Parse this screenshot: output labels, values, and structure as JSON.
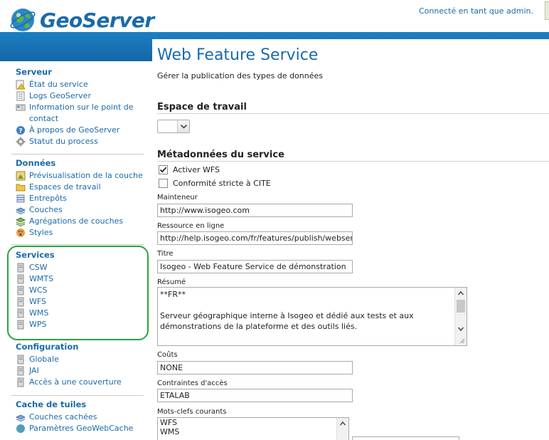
{
  "header": {
    "brand": "GeoServer",
    "login_status": "Connecté en tant que admin."
  },
  "sidebar": {
    "sections": [
      {
        "title": "Serveur",
        "items": [
          {
            "label": "État du service",
            "icon": "warning-icon"
          },
          {
            "label": "Logs GeoServer",
            "icon": "log-icon"
          },
          {
            "label": "Information sur le point de contact",
            "icon": "contact-card-icon"
          },
          {
            "label": "À propos de GeoServer",
            "icon": "help-icon"
          },
          {
            "label": "Statut du process",
            "icon": "gear-icon"
          }
        ]
      },
      {
        "title": "Données",
        "items": [
          {
            "label": "Prévisualisation de la couche",
            "icon": "preview-icon"
          },
          {
            "label": "Espaces de travail",
            "icon": "folder-icon"
          },
          {
            "label": "Entrepôts",
            "icon": "store-icon"
          },
          {
            "label": "Couches",
            "icon": "layer-icon"
          },
          {
            "label": "Agrégations de couches",
            "icon": "layer-group-icon"
          },
          {
            "label": "Styles",
            "icon": "palette-icon"
          }
        ]
      },
      {
        "title": "Services",
        "items": [
          {
            "label": "CSW",
            "icon": "server-icon"
          },
          {
            "label": "WMTS",
            "icon": "server-icon"
          },
          {
            "label": "WCS",
            "icon": "server-icon"
          },
          {
            "label": "WFS",
            "icon": "server-icon"
          },
          {
            "label": "WMS",
            "icon": "server-icon"
          },
          {
            "label": "WPS",
            "icon": "server-icon"
          }
        ]
      },
      {
        "title": "Configuration",
        "items": [
          {
            "label": "Globale",
            "icon": "server-icon"
          },
          {
            "label": "JAI",
            "icon": "server-icon"
          },
          {
            "label": "Accès à une couverture",
            "icon": "server-icon"
          }
        ]
      },
      {
        "title": "Cache de tuiles",
        "items": [
          {
            "label": "Couches cachées",
            "icon": "tile-layer-icon"
          },
          {
            "label": "Paramètres GeoWebCache",
            "icon": "globe-icon"
          }
        ]
      }
    ]
  },
  "main": {
    "title": "Web Feature Service",
    "description": "Gérer la publication des types de données",
    "workspace": {
      "heading": "Espace de travail",
      "value": ""
    },
    "metadata": {
      "heading": "Métadonnées du service",
      "enable_wfs": {
        "label": "Activer WFS",
        "checked": true
      },
      "strict_cite": {
        "label": "Conformité stricte à CITE",
        "checked": false
      },
      "maintainer": {
        "label": "Mainteneur",
        "value": "http://www.isogeo.com"
      },
      "online_resource": {
        "label": "Ressource en ligne",
        "value": "http://help.isogeo.com/fr/features/publish/webservices."
      },
      "title": {
        "label": "Titre",
        "value": "Isogeo - Web Feature Service de démonstration"
      },
      "abstract": {
        "label": "Résumé",
        "value": "**FR**\n\nServeur géographique interne à Isogeo et dédié aux tests et aux démonstrations de la plateforme et des outils liés."
      },
      "fees": {
        "label": "Coûts",
        "value": "NONE"
      },
      "access_constraints": {
        "label": "Contraintes d'accès",
        "value": "ETALAB"
      },
      "keywords": {
        "label": "Mots-clefs courants",
        "values": [
          "WFS",
          "WMS"
        ]
      }
    }
  },
  "colors": {
    "brand_blue": "#1a6aa9",
    "header_band": "#1c7fc3",
    "highlight_green": "#2ca33c"
  }
}
